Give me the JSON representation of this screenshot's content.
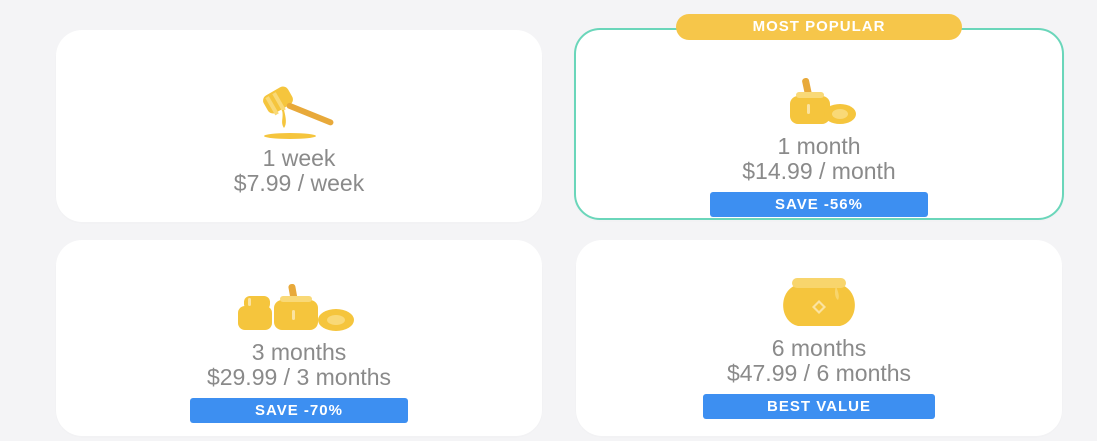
{
  "colors": {
    "background": "#f4f4f6",
    "card": "#ffffff",
    "selected_border": "#6ad6ba",
    "badge_blue": "#3d8ff1",
    "popular_yellow": "#f6c64a",
    "honey": "#f5c53d",
    "text_gray": "#8a8a8a"
  },
  "popular_label": "MOST POPULAR",
  "plans": [
    {
      "icon": "honey-dipper-icon",
      "title": "1 week",
      "price": "$7.99 / week",
      "badge": "",
      "selected": false
    },
    {
      "icon": "honey-jar-small-icon",
      "title": "1 month",
      "price": "$14.99 / month",
      "badge": "SAVE -56%",
      "selected": true
    },
    {
      "icon": "honey-jars-stack-icon",
      "title": "3 months",
      "price": "$29.99 / 3 months",
      "badge": "SAVE -70%",
      "selected": false
    },
    {
      "icon": "honey-pot-icon",
      "title": "6 months",
      "price": "$47.99 / 6 months",
      "badge": "BEST VALUE",
      "selected": false
    }
  ]
}
